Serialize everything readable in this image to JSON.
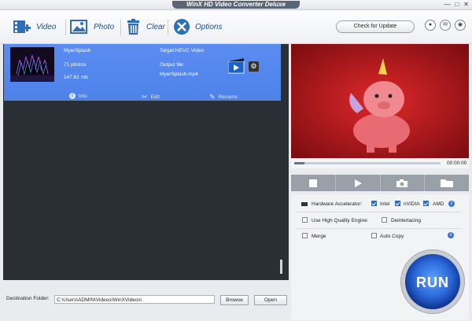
{
  "window": {
    "title": "WinX HD Video Converter Deluxe",
    "controls": [
      "—",
      "□",
      "✕"
    ]
  },
  "toolbar": {
    "video_label": "Video",
    "photo_label": "Photo",
    "clear_label": "Clear",
    "options_label": "Options",
    "check_update_label": "Check for Update",
    "icons": [
      "video-add-icon",
      "photo-add-icon",
      "trash-icon",
      "wrench-icon",
      "user-icon",
      "mail-icon",
      "globe-icon"
    ]
  },
  "file_item": {
    "name": "MyerSplash",
    "photos": "71 photos",
    "size": "147.61 mb",
    "target": "Target:HEVC Video",
    "output_label": "Output file:",
    "output_file": "MyerSplash.mp4",
    "actions": {
      "info": "Info",
      "edit": "Edit",
      "rename": "Rename"
    }
  },
  "destination": {
    "label": "Destination Folder:",
    "path": "C:\\Users\\ADMIN\\Videos\\WinXVideos\\",
    "browse": "Browse",
    "open": "Open"
  },
  "player": {
    "time": "00:00:00",
    "progress": 0.07
  },
  "options": {
    "hardware_accelerator": "Hardware Accelerator:",
    "intel": "Intel",
    "intel_checked": true,
    "nvidia": "nVIDIA",
    "nvidia_checked": true,
    "amd": "AMD",
    "amd_checked": true,
    "high_quality": "Use High Quality Engine",
    "high_quality_checked": false,
    "deinterlacing": "Deinterlacing",
    "deinterlacing_checked": false,
    "merge": "Merge",
    "merge_checked": false,
    "auto_copy": "Auto Copy",
    "auto_copy_checked": false
  },
  "run": {
    "label": "RUN"
  },
  "colors": {
    "accent": "#4d82ea",
    "run_blue": "#2a67d8",
    "preview_bg": "#c81d22"
  }
}
